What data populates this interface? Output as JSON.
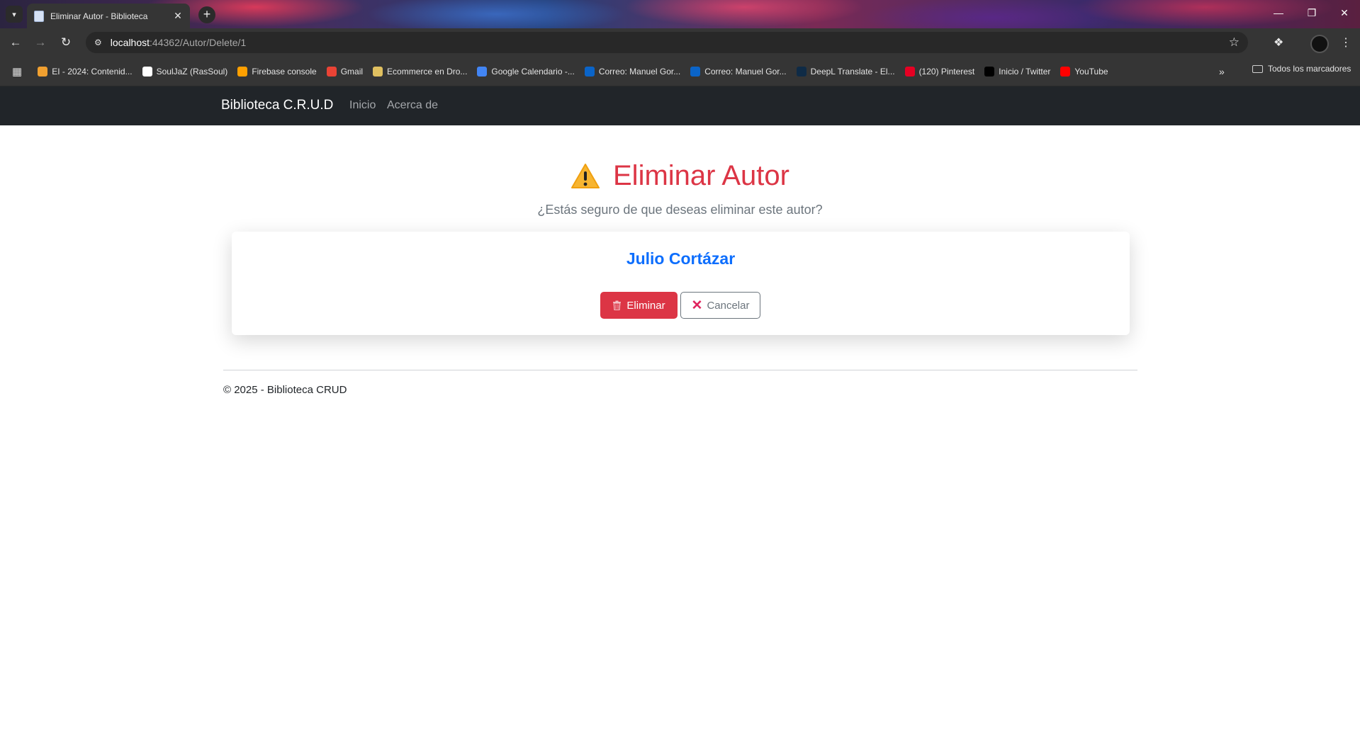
{
  "browser": {
    "tab_title": "Eliminar Autor - Biblioteca",
    "url_host": "localhost",
    "url_path": ":44362/Autor/Delete/1",
    "bookmarks": [
      {
        "label": "EI - 2024: Contenid...",
        "icon_color": "#f0a030"
      },
      {
        "label": "SoulJaZ (RasSoul)",
        "icon_color": "#ffffff"
      },
      {
        "label": "Firebase console",
        "icon_color": "#ffa000"
      },
      {
        "label": "Gmail",
        "icon_color": "#ea4335"
      },
      {
        "label": "Ecommerce en Dro...",
        "icon_color": "#e0c060"
      },
      {
        "label": "Google Calendario -...",
        "icon_color": "#4285f4"
      },
      {
        "label": "Correo: Manuel Gor...",
        "icon_color": "#0a64c8"
      },
      {
        "label": "Correo: Manuel Gor...",
        "icon_color": "#0a64c8"
      },
      {
        "label": "DeepL Translate - El...",
        "icon_color": "#0f2b46"
      },
      {
        "label": "(120) Pinterest",
        "icon_color": "#e60023"
      },
      {
        "label": "Inicio / Twitter",
        "icon_color": "#000000"
      },
      {
        "label": "YouTube",
        "icon_color": "#ff0000"
      }
    ],
    "all_bookmarks_label": "Todos los marcadores"
  },
  "navbar": {
    "brand": "Biblioteca C.R.U.D",
    "links": [
      "Inicio",
      "Acerca de"
    ]
  },
  "page": {
    "title": "Eliminar Autor",
    "subtitle": "¿Estás seguro de que deseas eliminar este autor?",
    "author_name": "Julio Cortázar",
    "delete_label": "Eliminar",
    "cancel_label": "Cancelar",
    "footer": "© 2025 - Biblioteca CRUD"
  },
  "colors": {
    "danger": "#dc3545",
    "primary": "#0d6efd",
    "secondary": "#6c757d",
    "navbar": "#212529"
  }
}
